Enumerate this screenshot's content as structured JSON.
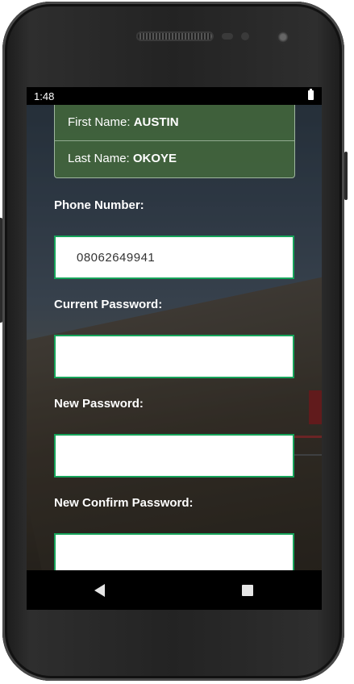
{
  "status_bar": {
    "time": "1:48"
  },
  "profile": {
    "first_name_label": "First Name: ",
    "first_name_value": "AUSTIN",
    "last_name_label": "Last Name: ",
    "last_name_value": "OKOYE"
  },
  "form": {
    "phone_label": "Phone Number:",
    "phone_value": "08062649941",
    "current_password_label": "Current Password:",
    "current_password_value": "",
    "new_password_label": "New Password:",
    "new_password_value": "",
    "confirm_password_label": "New Confirm Password:",
    "confirm_password_value": ""
  },
  "nav": {
    "back_icon": "back-triangle-icon",
    "recent_icon": "recent-apps-square-icon"
  },
  "colors": {
    "field_border": "#16a35a",
    "card_bg": "#466e3c"
  }
}
